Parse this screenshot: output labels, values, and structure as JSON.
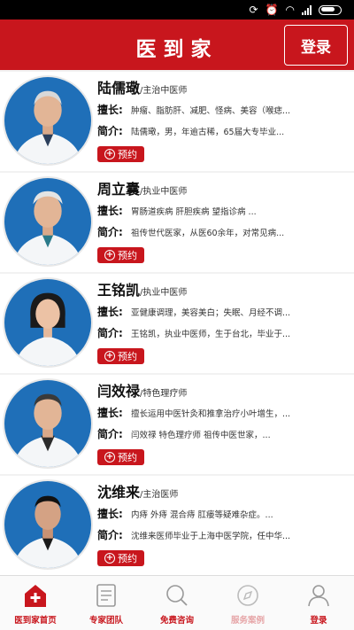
{
  "app": {
    "title": "医到家",
    "login_label": "登录"
  },
  "doctors": [
    {
      "name": "陆儒璥",
      "title": "/主治中医师",
      "specialty_label": "擅长:",
      "specialty": "肿瘤、脂肪肝、减肥、怪病、美容（喉痣...",
      "intro_label": "简介:",
      "intro": "陆儒璥，男，年逾古稀，65届大专毕业...",
      "book_label": "预约"
    },
    {
      "name": "周立囊",
      "title": "/执业中医师",
      "specialty_label": "擅长:",
      "specialty": "胃肠道疾病 肝胆疾病 望指诊病 ...",
      "intro_label": "简介:",
      "intro": "祖传世代医家，从医60余年，对常见病...",
      "book_label": "预约"
    },
    {
      "name": "王铭凯",
      "title": "/执业中医师",
      "specialty_label": "擅长:",
      "specialty": "亚健康调理，美容美白；失眠、月经不调...",
      "intro_label": "简介:",
      "intro": "王铭凯，执业中医师，生于台北，毕业于...",
      "book_label": "预约"
    },
    {
      "name": "闫效禄",
      "title": "/特色理疗师",
      "specialty_label": "擅长:",
      "specialty": "擅长运用中医针灸和推拿治疗小叶增生，...",
      "intro_label": "简介:",
      "intro": "闫效禄 特色理疗师 祖传中医世家，...",
      "book_label": "预约"
    },
    {
      "name": "沈维来",
      "title": "/主治医师",
      "specialty_label": "擅长:",
      "specialty": "内痔 外痔 混合痔 肛瘘等疑难杂症。...",
      "intro_label": "简介:",
      "intro": "沈维来医师毕业于上海中医学院，任中华...",
      "book_label": "预约"
    }
  ],
  "tabs": [
    {
      "label": "医到家首页",
      "icon": "home-icon"
    },
    {
      "label": "专家团队",
      "icon": "document-icon"
    },
    {
      "label": "免费咨询",
      "icon": "search-icon"
    },
    {
      "label": "服务案例",
      "icon": "compass-icon"
    },
    {
      "label": "登录",
      "icon": "user-icon"
    }
  ],
  "colors": {
    "brand_red": "#c8161d",
    "avatar_bg": "#1f6fb8"
  }
}
